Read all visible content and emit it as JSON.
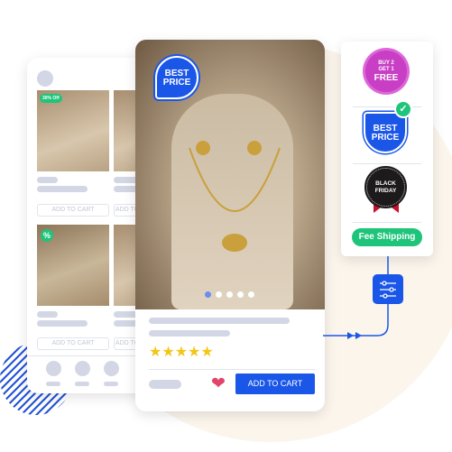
{
  "left_card": {
    "products": [
      {
        "badge": "30% Off",
        "cta": "ADD TO CART"
      },
      {
        "badge": "",
        "cta": "ADD TO CART"
      },
      {
        "badge": "%",
        "cta": "ADD TO CART"
      },
      {
        "badge": "",
        "cta": "ADD TO CART"
      }
    ]
  },
  "main_card": {
    "badge": "BEST PRICE",
    "carousel": {
      "total": 5,
      "active": 1
    },
    "rating": 5,
    "add_to_cart": "ADD TO CART"
  },
  "badge_panel": {
    "badges": [
      {
        "label": "BUY 2 GET 1 FREE",
        "l1": "BUY 2",
        "l2": "GET 1",
        "l3": "FREE",
        "color": "#c83ec4"
      },
      {
        "label": "BEST PRICE",
        "l1": "BEST",
        "l2": "PRICE",
        "color": "#1a56e8",
        "selected": true
      },
      {
        "label": "BLACK FRIDAY",
        "l1": "BLACK",
        "l2": "FRIDAY",
        "color": "#1c1a1a"
      },
      {
        "label": "Fee Shipping",
        "color": "#1ec47a"
      }
    ]
  },
  "colors": {
    "accent": "#1a56e8",
    "green": "#1ec47a",
    "star": "#f5c518",
    "heart": "#e0456a",
    "background_circle": "#fbf5ec"
  },
  "icons": [
    "sliders-icon",
    "heart-icon",
    "star-icon",
    "check-icon",
    "percent-icon"
  ]
}
